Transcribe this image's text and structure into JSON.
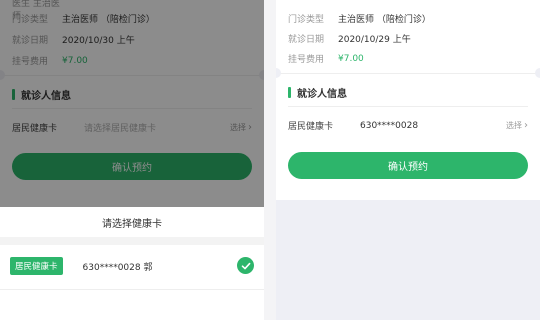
{
  "left": {
    "top_row_partial": "医生   主治医师",
    "info": [
      {
        "key": "门诊类型",
        "value": "主治医师 （陪检门诊）"
      },
      {
        "key": "就诊日期",
        "value": "2020/10/30 上午"
      },
      {
        "key": "挂号费用",
        "value": "¥7.00"
      }
    ],
    "patient_section_title": "就诊人信息",
    "health_card_key": "居民健康卡",
    "health_card_placeholder": "请选择居民健康卡",
    "select_label": "选择",
    "confirm_button": "确认预约",
    "sheet": {
      "title": "请选择健康卡",
      "item_badge": "居民健康卡",
      "item_number": "630****0028 郭"
    }
  },
  "right": {
    "info": [
      {
        "key": "门诊类型",
        "value": "主治医师 （陪检门诊）"
      },
      {
        "key": "就诊日期",
        "value": "2020/10/29 上午"
      },
      {
        "key": "挂号费用",
        "value": "¥7.00"
      }
    ],
    "patient_section_title": "就诊人信息",
    "health_card_key": "居民健康卡",
    "health_card_value": "630****0028",
    "select_label": "选择",
    "confirm_button": "确认预约"
  },
  "colors": {
    "accent": "#2db56b",
    "overlay": "rgba(0,0,0,0.45)"
  }
}
